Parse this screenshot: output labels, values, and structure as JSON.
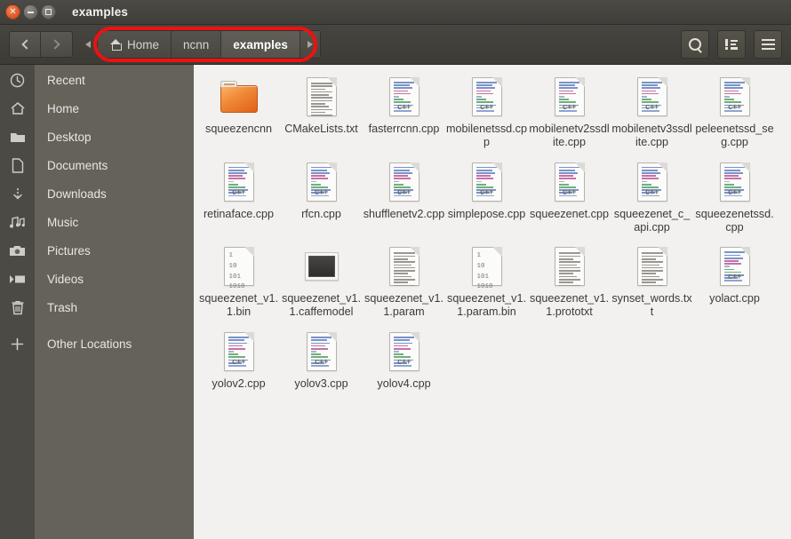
{
  "window": {
    "title": "examples",
    "buttons": {
      "close": "close-button",
      "minimize": "minimize-button",
      "maximize": "maximize-button"
    }
  },
  "toolbar": {
    "back_label": "Back",
    "forward_label": "Forward",
    "breadcrumb_prev_label": "Previous path",
    "breadcrumb_next_label": "Next path",
    "breadcrumbs": [
      {
        "label": "Home",
        "icon": "home-icon",
        "active": false
      },
      {
        "label": "ncnn",
        "icon": "",
        "active": false
      },
      {
        "label": "examples",
        "icon": "",
        "active": true
      }
    ],
    "search_label": "Search",
    "view_toggle_label": "View options",
    "menu_label": "Menu"
  },
  "annotation": {
    "color": "#ee1111",
    "target": "breadcrumb-bar"
  },
  "sidebar": {
    "items": [
      {
        "label": "Recent",
        "icon": "clock-icon"
      },
      {
        "label": "Home",
        "icon": "home-icon"
      },
      {
        "label": "Desktop",
        "icon": "folder-icon"
      },
      {
        "label": "Documents",
        "icon": "document-icon"
      },
      {
        "label": "Downloads",
        "icon": "download-icon"
      },
      {
        "label": "Music",
        "icon": "music-icon"
      },
      {
        "label": "Pictures",
        "icon": "camera-icon"
      },
      {
        "label": "Videos",
        "icon": "video-icon"
      },
      {
        "label": "Trash",
        "icon": "trash-icon"
      },
      {
        "label": "Other Locations",
        "icon": "plus-icon"
      }
    ]
  },
  "content": {
    "files": [
      {
        "name": "squeezencnn",
        "type": "folder"
      },
      {
        "name": "CMakeLists.txt",
        "type": "text"
      },
      {
        "name": "fasterrcnn.cpp",
        "type": "cpp"
      },
      {
        "name": "mobilenetssd.cpp",
        "type": "cpp"
      },
      {
        "name": "mobilenetv2ssdlite.cpp",
        "type": "cpp"
      },
      {
        "name": "mobilenetv3ssdlite.cpp",
        "type": "cpp"
      },
      {
        "name": "peleenetssd_seg.cpp",
        "type": "cpp"
      },
      {
        "name": "retinaface.cpp",
        "type": "cpp"
      },
      {
        "name": "rfcn.cpp",
        "type": "cpp"
      },
      {
        "name": "shufflenetv2.cpp",
        "type": "cpp"
      },
      {
        "name": "simplepose.cpp",
        "type": "cpp"
      },
      {
        "name": "squeezenet.cpp",
        "type": "cpp"
      },
      {
        "name": "squeezenet_c_api.cpp",
        "type": "cpp"
      },
      {
        "name": "squeezenetssd.cpp",
        "type": "cpp"
      },
      {
        "name": "squeezenet_v1.1.bin",
        "type": "binary"
      },
      {
        "name": "squeezenet_v1.1.caffemodel",
        "type": "image"
      },
      {
        "name": "squeezenet_v1.1.param",
        "type": "text"
      },
      {
        "name": "squeezenet_v1.1.param.bin",
        "type": "binary"
      },
      {
        "name": "squeezenet_v1.1.prototxt",
        "type": "text"
      },
      {
        "name": "synset_words.txt",
        "type": "text"
      },
      {
        "name": "yolact.cpp",
        "type": "cpp"
      },
      {
        "name": "yolov2.cpp",
        "type": "cpp"
      },
      {
        "name": "yolov3.cpp",
        "type": "cpp"
      },
      {
        "name": "yolov4.cpp",
        "type": "cpp"
      }
    ],
    "binary_icon_text": [
      "1",
      "10",
      "101",
      "1010"
    ],
    "cpp_icon_tag": "c++"
  },
  "colors": {
    "titlebar": "#443f3a",
    "sidebar": "#65625a",
    "icon_strip": "#4c4a44",
    "content_bg": "#f2f1f0",
    "accent_folder": "#e87b2a",
    "annotation": "#ee1111"
  }
}
